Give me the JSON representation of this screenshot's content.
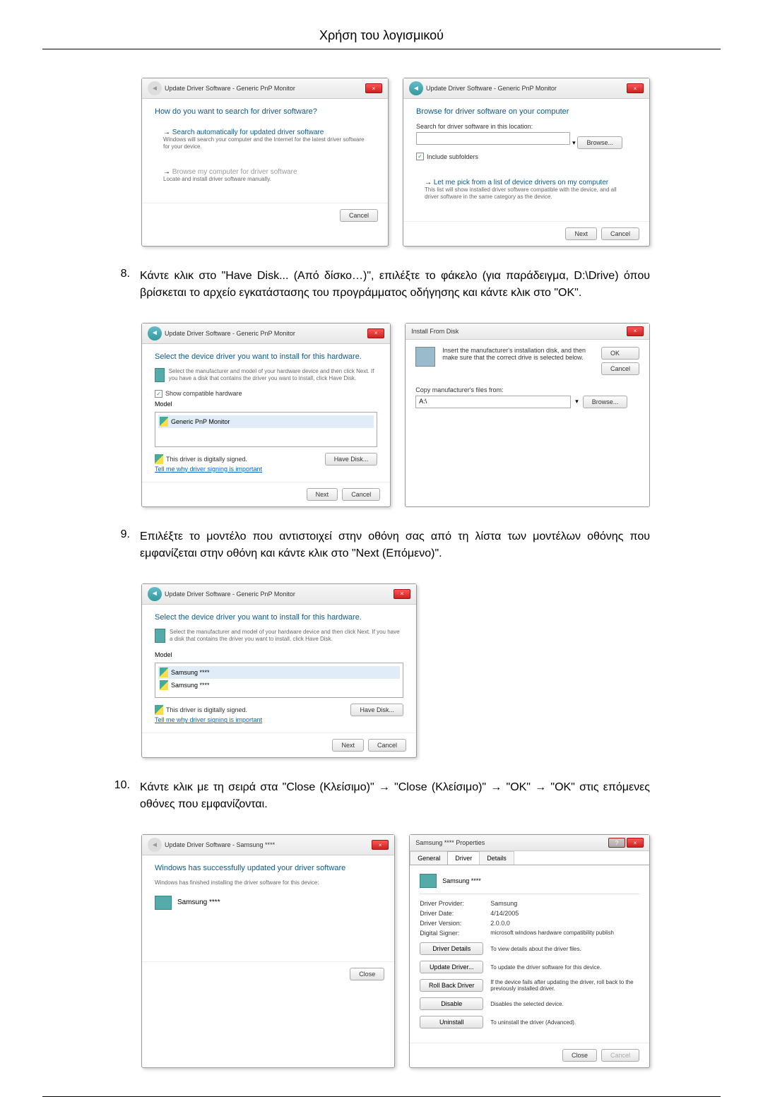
{
  "header": "Χρήση του λογισμικού",
  "steps": {
    "s8": {
      "num": "8.",
      "text": "Κάντε κλικ στο \"Have Disk... (Από δίσκο…)\", επιλέξτε το φάκελο (για παράδειγμα, D:\\Drive) όπου βρίσκεται το αρχείο εγκατάστασης του προγράμματος οδήγησης και κάντε κλικ στο \"OK\"."
    },
    "s9": {
      "num": "9.",
      "text": "Επιλέξτε το μοντέλο που αντιστοιχεί στην οθόνη σας από τη λίστα των μοντέλων οθόνης που εμφανίζεται στην οθόνη και κάντε κλικ στο \"Next (Επόμενο)\"."
    },
    "s10": {
      "num": "10.",
      "text": "Κάντε κλικ με τη σειρά στα \"Close (Κλείσιμο)\" → \"Close (Κλείσιμο)\" → \"OK\" → \"OK\" στις επόμενες οθόνες που εμφανίζονται."
    }
  },
  "dlg1_left": {
    "header": "Update Driver Software - Generic PnP Monitor",
    "title": "How do you want to search for driver software?",
    "opt1_title": "Search automatically for updated driver software",
    "opt1_desc": "Windows will search your computer and the Internet for the latest driver software for your device.",
    "opt2_title": "Browse my computer for driver software",
    "opt2_desc": "Locate and install driver software manually.",
    "cancel": "Cancel"
  },
  "dlg1_right": {
    "header": "Update Driver Software - Generic PnP Monitor",
    "title": "Browse for driver software on your computer",
    "search_label": "Search for driver software in this location:",
    "browse": "Browse...",
    "include": "Include subfolders",
    "opt_title": "Let me pick from a list of device drivers on my computer",
    "opt_desc": "This list will show installed driver software compatible with the device, and all driver software in the same category as the device.",
    "next": "Next",
    "cancel": "Cancel"
  },
  "dlg2_left": {
    "header": "Update Driver Software - Generic PnP Monitor",
    "title": "Select the device driver you want to install for this hardware.",
    "desc": "Select the manufacturer and model of your hardware device and then click Next. If you have a disk that contains the driver you want to install, click Have Disk.",
    "compat": "Show compatible hardware",
    "model_label": "Model",
    "model1": "Generic PnP Monitor",
    "signed": "This driver is digitally signed.",
    "tell_link": "Tell me why driver signing is important",
    "have_disk": "Have Disk...",
    "next": "Next",
    "cancel": "Cancel"
  },
  "dlg2_right": {
    "title_bar": "Install From Disk",
    "msg": "Insert the manufacturer's installation disk, and then make sure that the correct drive is selected below.",
    "ok": "OK",
    "cancel": "Cancel",
    "copy_label": "Copy manufacturer's files from:",
    "browse": "Browse..."
  },
  "dlg3": {
    "header": "Update Driver Software - Generic PnP Monitor",
    "title": "Select the device driver you want to install for this hardware.",
    "desc": "Select the manufacturer and model of your hardware device and then click Next. If you have a disk that contains the driver you want to install, click Have Disk.",
    "model_label": "Model",
    "model1": "Samsung ****",
    "model2": "Samsung ****",
    "signed": "This driver is digitally signed.",
    "tell_link": "Tell me why driver signing is important",
    "have_disk": "Have Disk...",
    "next": "Next",
    "cancel": "Cancel"
  },
  "dlg4_left": {
    "header": "Update Driver Software - Samsung ****",
    "title": "Windows has successfully updated your driver software",
    "desc": "Windows has finished installing the driver software for this device:",
    "device": "Samsung ****",
    "close": "Close"
  },
  "dlg4_right": {
    "title_bar": "Samsung **** Properties",
    "tabs": {
      "general": "General",
      "driver": "Driver",
      "details": "Details"
    },
    "device": "Samsung ****",
    "rows": {
      "provider_l": "Driver Provider:",
      "provider_v": "Samsung",
      "date_l": "Driver Date:",
      "date_v": "4/14/2005",
      "version_l": "Driver Version:",
      "version_v": "2.0.0.0",
      "signer_l": "Digital Signer:",
      "signer_v": "microsoft windows hardware compatibility publish"
    },
    "actions": {
      "details_btn": "Driver Details",
      "details_desc": "To view details about the driver files.",
      "update_btn": "Update Driver...",
      "update_desc": "To update the driver software for this device.",
      "rollback_btn": "Roll Back Driver",
      "rollback_desc": "If the device fails after updating the driver, roll back to the previously installed driver.",
      "disable_btn": "Disable",
      "disable_desc": "Disables the selected device.",
      "uninstall_btn": "Uninstall",
      "uninstall_desc": "To uninstall the driver (Advanced)."
    },
    "close": "Close",
    "cancel": "Cancel"
  }
}
